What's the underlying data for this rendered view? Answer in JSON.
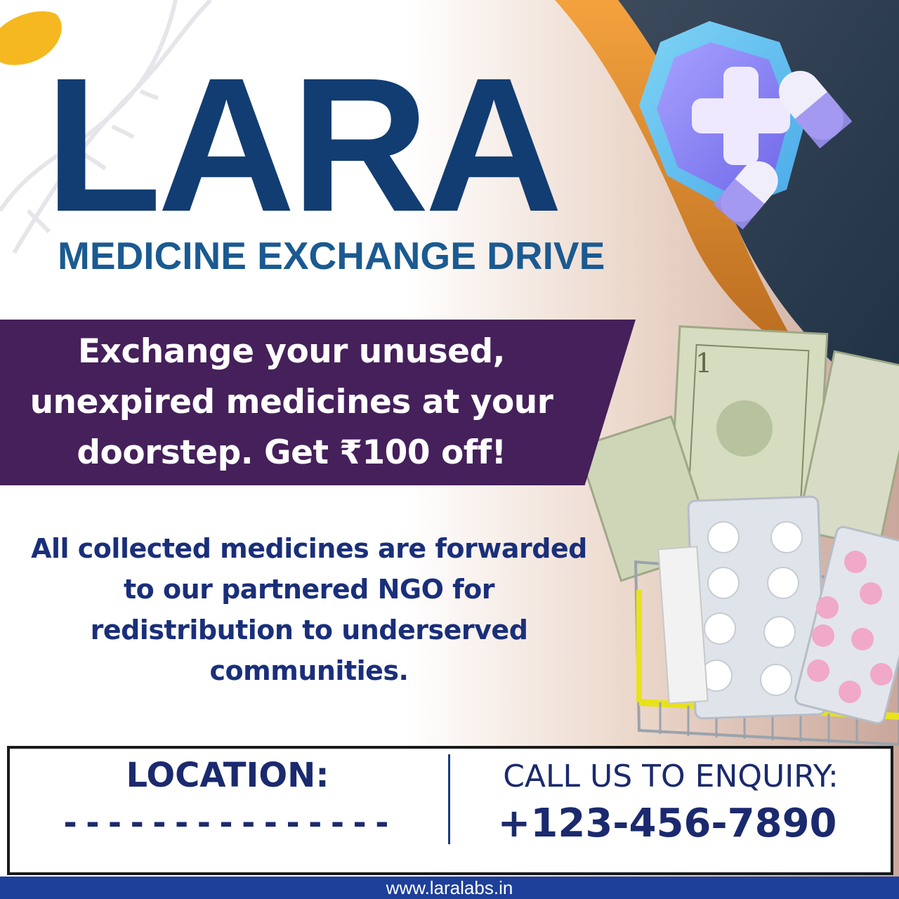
{
  "brand": {
    "name": "LARA",
    "subtitle": "MEDICINE EXCHANGE DRIVE"
  },
  "banner": {
    "text": "Exchange your unused, unexpired medicines at your doorstep. Get ₹100 off!"
  },
  "info": {
    "text": "All collected medicines are forwarded to our partnered NGO for redistribution to underserved communities."
  },
  "contact": {
    "location_label": "LOCATION:",
    "location_value": "---------------",
    "call_label": "CALL US TO ENQUIRY:",
    "phone": "+123-456-7890"
  },
  "footer": {
    "website": "www.laralabs.in"
  },
  "colors": {
    "brand_navy": "#123d72",
    "subtitle_blue": "#1b5a91",
    "banner_purple": "#45205a",
    "text_navy": "#1a2f7a",
    "accent_orange": "#e08a2a",
    "footer_blue": "#1e3f9a"
  },
  "icons": [
    "medical-shield-icon",
    "pill-capsule-icon",
    "dna-helix-icon",
    "banknotes-image",
    "shopping-basket-image",
    "pill-blister-pack-image"
  ]
}
